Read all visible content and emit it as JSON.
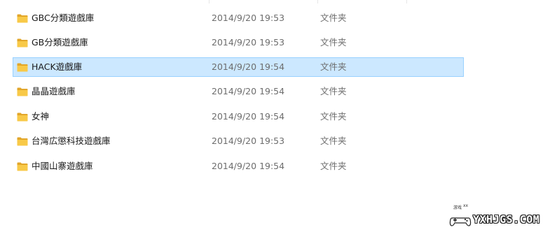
{
  "files": [
    {
      "name": "GBC分類遊戲庫",
      "date": "2014/9/20 19:53",
      "type": "文件夹",
      "selected": false
    },
    {
      "name": "GB分類遊戲庫",
      "date": "2014/9/20 19:53",
      "type": "文件夹",
      "selected": false
    },
    {
      "name": "HACK遊戲庫",
      "date": "2014/9/20 19:54",
      "type": "文件夹",
      "selected": true
    },
    {
      "name": "晶晶遊戲庫",
      "date": "2014/9/20 19:54",
      "type": "文件夹",
      "selected": false
    },
    {
      "name": "女神",
      "date": "2014/9/20 19:54",
      "type": "文件夹",
      "selected": false
    },
    {
      "name": "台灣広懲科技遊戲庫",
      "date": "2014/9/20 19:53",
      "type": "文件夹",
      "selected": false
    },
    {
      "name": "中國山寨遊戲庫",
      "date": "2014/9/20 19:54",
      "type": "文件夹",
      "selected": false
    }
  ],
  "watermark": {
    "text": "YXHJGS.COM",
    "logo_icon": "gamepad-icon"
  },
  "colors": {
    "selection_bg": "#cce8ff",
    "selection_border": "#99d1ff",
    "folder": "#f8c948",
    "secondary_text": "#6d6d6d"
  }
}
